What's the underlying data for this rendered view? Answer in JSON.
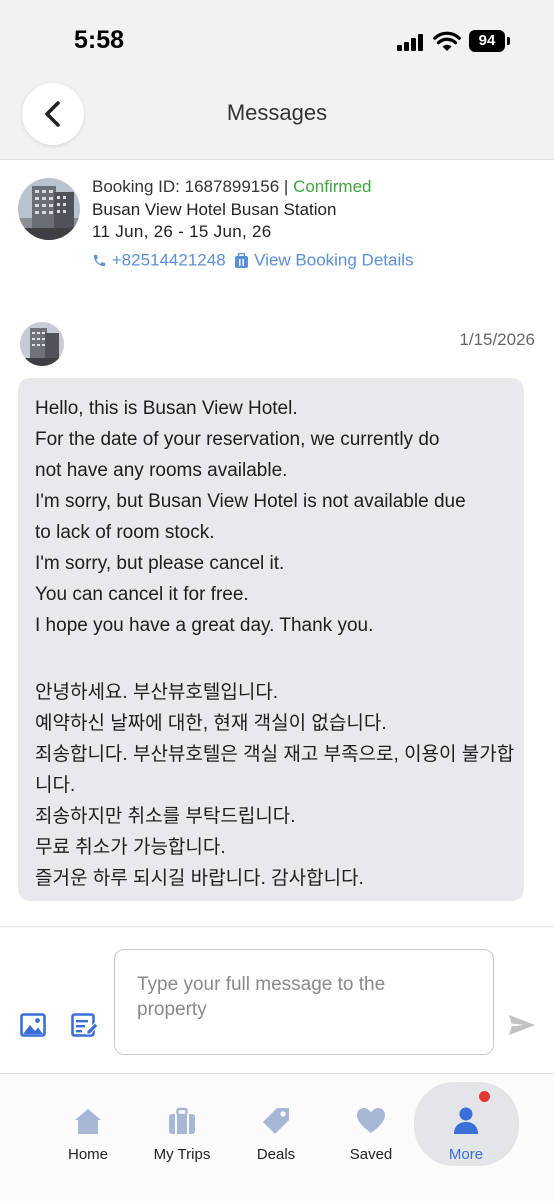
{
  "status_bar": {
    "time": "5:58",
    "battery": "94"
  },
  "header": {
    "title": "Messages"
  },
  "booking": {
    "id_label": "Booking ID:",
    "id": "1687899156",
    "separator": "|",
    "status": "Confirmed",
    "hotel_name": "Busan View Hotel Busan Station",
    "dates": "11 Jun, 26 - 15 Jun, 26",
    "phone": "+82514421248",
    "view_details": "View Booking Details"
  },
  "message": {
    "date": "1/15/2026",
    "lines": [
      "Hello, this is Busan View Hotel.",
      "For the date of your reservation, we currently do",
      "not have any rooms available.",
      "I'm sorry, but Busan View Hotel is not available due",
      "to lack of room stock.",
      "I'm sorry, but please cancel it.",
      "You can cancel it for free.",
      "I hope you have a great day. Thank you.",
      "안녕하세요. 부산뷰호텔입니다.",
      "예약하신 날짜에 대한, 현재 객실이 없습니다.",
      "죄송합니다. 부산뷰호텔은 객실 재고 부족으로, 이용이 불가합",
      "니다.",
      "죄송하지만 취소를 부탁드립니다.",
      "무료 취소가 가능합니다.",
      "즐거운 하루 되시길 바랍니다. 감사합니다."
    ]
  },
  "compose": {
    "placeholder": "Type your full message to the property"
  },
  "tabbar": {
    "items": [
      {
        "label": "Home",
        "icon": "home-icon"
      },
      {
        "label": "My Trips",
        "icon": "suitcase-icon"
      },
      {
        "label": "Deals",
        "icon": "tag-icon"
      },
      {
        "label": "Saved",
        "icon": "heart-icon"
      },
      {
        "label": "More",
        "icon": "person-icon"
      }
    ],
    "active": "More"
  },
  "colors": {
    "accent": "#5b8fd6",
    "confirmed": "#3fa33f",
    "tab_icon": "#a8b7d6",
    "active_icon": "#3a6fd8",
    "badge": "#e53935"
  }
}
